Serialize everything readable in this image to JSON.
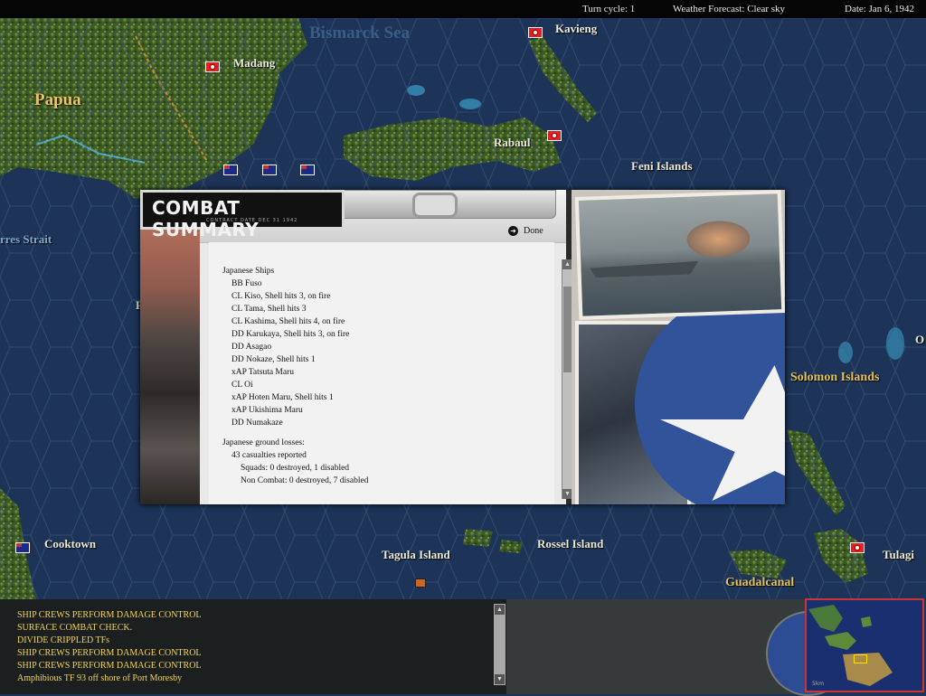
{
  "topbar": {
    "turn": "Turn cycle: 1",
    "weather": "Weather Forecast: Clear sky",
    "date": "Date: Jan 6, 1942"
  },
  "map": {
    "sea_name": "Bismarck Sea",
    "region": "Papua",
    "strait": "rres Strait",
    "places": [
      "Madang",
      "Kavieng",
      "Rabaul",
      "Feni Islands",
      "Cooktown",
      "Tagula Island",
      "Rossel Island",
      "Tulagi"
    ],
    "gold_places": [
      "Solomon Islands",
      "Guadalcanal"
    ],
    "edge_o": "O",
    "edge_p": "P"
  },
  "dialog": {
    "title": "COMBAT SUMMARY",
    "subtitle": "CONTRACT DATE DEC 31 1942",
    "done_label": "Done",
    "lines": [
      {
        "text": "Japanese Ships",
        "indent": 0
      },
      {
        "text": "BB Fuso",
        "indent": 1
      },
      {
        "text": "CL Kiso, Shell hits 3,  on fire",
        "indent": 1
      },
      {
        "text": "CL Tama, Shell hits 3",
        "indent": 1
      },
      {
        "text": "CL Kashima, Shell hits 4,  on fire",
        "indent": 1
      },
      {
        "text": "DD Karukaya, Shell hits 3,  on fire",
        "indent": 1
      },
      {
        "text": "DD Asagao",
        "indent": 1
      },
      {
        "text": "DD Nokaze, Shell hits 1",
        "indent": 1
      },
      {
        "text": "xAP Tatsuta Maru",
        "indent": 1
      },
      {
        "text": "CL Oi",
        "indent": 1
      },
      {
        "text": "xAP Hoten Maru, Shell hits 1",
        "indent": 1
      },
      {
        "text": "xAP Ukishima Maru",
        "indent": 1
      },
      {
        "text": "DD Numakaze",
        "indent": 1
      },
      {
        "text": "",
        "indent": -1
      },
      {
        "text": "Japanese ground losses:",
        "indent": 0
      },
      {
        "text": "43 casualties reported",
        "indent": 1
      },
      {
        "text": "Squads: 0 destroyed, 1 disabled",
        "indent": 2
      },
      {
        "text": "Non Combat: 0 destroyed, 7 disabled",
        "indent": 2
      }
    ]
  },
  "messages": [
    "SHIP CREWS PERFORM DAMAGE CONTROL",
    "SURFACE COMBAT CHECK.",
    "DIVIDE CRIPPLED TFs",
    "SHIP CREWS PERFORM DAMAGE CONTROL",
    "SHIP CREWS PERFORM DAMAGE CONTROL",
    "Amphibious TF 93 off shore of Port Moresby"
  ],
  "minimap": {
    "zoom_label": "5km"
  },
  "colors": {
    "ocean": "#1d3357",
    "land": "#3d5a22",
    "message_text": "#f3d45c",
    "place_gold": "#e4c35a"
  },
  "icons": {
    "done": "arrow-right-circle-icon",
    "scroll_up": "triangle-up-icon",
    "scroll_down": "triangle-down-icon",
    "japanese_flag": "rising-sun-flag-icon",
    "allied_flag": "australian-flag-icon"
  }
}
